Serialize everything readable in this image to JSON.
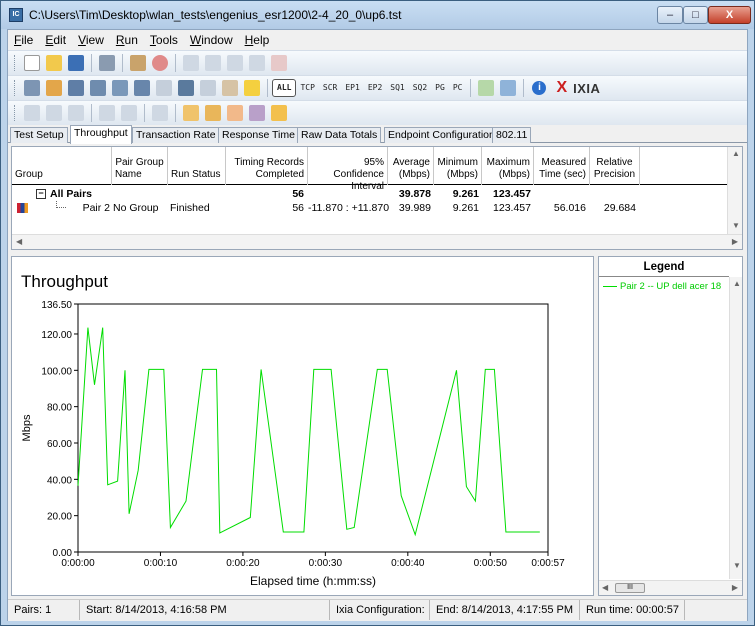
{
  "window": {
    "title": "C:\\Users\\Tim\\Desktop\\wlan_tests\\engenius_esr1200\\2-4_20_0\\up6.tst",
    "app_icon": "ixchariot-app-icon",
    "min_glyph": "–",
    "max_glyph": "□",
    "close_glyph": "X"
  },
  "menu": [
    "File",
    "Edit",
    "View",
    "Run",
    "Tools",
    "Window",
    "Help"
  ],
  "toolbar2": {
    "filters": [
      "ALL",
      "TCP",
      "SCR",
      "EP1",
      "EP2",
      "SQ1",
      "SQ2",
      "PG",
      "PC"
    ],
    "logo": "IXIA"
  },
  "tabs": [
    "Test Setup",
    "Throughput",
    "Transaction Rate",
    "Response Time",
    "Raw Data Totals",
    "Endpoint Configuration",
    "802.11"
  ],
  "active_tab": "Throughput",
  "grid": {
    "headers": {
      "group": "Group",
      "pair_group_name": [
        "Pair Group",
        "Name"
      ],
      "run_status": "Run Status",
      "timing_records": [
        "Timing Records",
        "Completed"
      ],
      "confidence": [
        "95% Confidence",
        "Interval"
      ],
      "average": [
        "Average",
        "(Mbps)"
      ],
      "minimum": [
        "Minimum",
        "(Mbps)"
      ],
      "maximum": [
        "Maximum",
        "(Mbps)"
      ],
      "measured_time": [
        "Measured",
        "Time (sec)"
      ],
      "relative_precision": [
        "Relative",
        "Precision"
      ]
    },
    "summary_row": {
      "expander": "−",
      "group": "All Pairs",
      "timing_records": "56",
      "average": "39.878",
      "minimum": "9.261",
      "maximum": "123.457"
    },
    "pair_row": {
      "group": "Pair 2",
      "pair_group_name": "No Group",
      "run_status": "Finished",
      "timing_records": "56",
      "confidence": "-11.870 : +11.870",
      "average": "39.989",
      "minimum": "9.261",
      "maximum": "123.457",
      "measured_time": "56.016",
      "relative_precision": "29.684"
    }
  },
  "legend": {
    "title": "Legend",
    "entry": "Pair 2 -- UP dell acer 18",
    "thumb": "III"
  },
  "status": {
    "pairs": "Pairs: 1",
    "start": "Start: 8/14/2013, 4:16:58 PM",
    "config": "Ixia Configuration:",
    "end": "End: 8/14/2013, 4:17:55 PM",
    "runtime": "Run time: 00:00:57"
  },
  "chart_data": {
    "type": "line",
    "title": "Throughput",
    "xlabel": "Elapsed time (h:mm:ss)",
    "ylabel": "Mbps",
    "xlim": [
      0,
      57
    ],
    "ylim": [
      0,
      136.5
    ],
    "xticks": [
      0,
      10,
      20,
      30,
      40,
      50,
      57
    ],
    "xtick_labels": [
      "0:00:00",
      "0:00:10",
      "0:00:20",
      "0:00:30",
      "0:00:40",
      "0:00:50",
      "0:00:57"
    ],
    "yticks": [
      0,
      20,
      40,
      60,
      80,
      100,
      120,
      136.5
    ],
    "ytick_labels": [
      "0.00",
      "20.00",
      "40.00",
      "60.00",
      "80.00",
      "100.00",
      "120.00",
      "136.50"
    ],
    "grid": false,
    "color": "#00dd00",
    "series": [
      {
        "name": "Pair 2 -- UP dell acer 18",
        "x": [
          0,
          1.2,
          2.0,
          3.0,
          3.6,
          4.8,
          5.7,
          6.2,
          7.3,
          8.6,
          10.4,
          11.2,
          13.1,
          15.1,
          16.8,
          17.2,
          20.9,
          22.2,
          24.9,
          27.4,
          28.6,
          30.7,
          32.6,
          33.5,
          36.3,
          37.5,
          39.2,
          40.9,
          45.9,
          47.1,
          48.2,
          49.4,
          50.5,
          51.9,
          53.0,
          56.0
        ],
        "y": [
          36.5,
          123.5,
          92.0,
          123.5,
          37.0,
          39.0,
          100.0,
          21.0,
          45.0,
          100.5,
          100.5,
          13.5,
          28.0,
          100.5,
          100.5,
          10.5,
          19.0,
          100.5,
          11.0,
          11.0,
          100.5,
          100.5,
          12.5,
          13.5,
          100.5,
          100.5,
          31.0,
          9.5,
          100.0,
          36.0,
          28.0,
          100.5,
          100.5,
          11.0,
          11.0,
          11.0
        ]
      }
    ]
  }
}
